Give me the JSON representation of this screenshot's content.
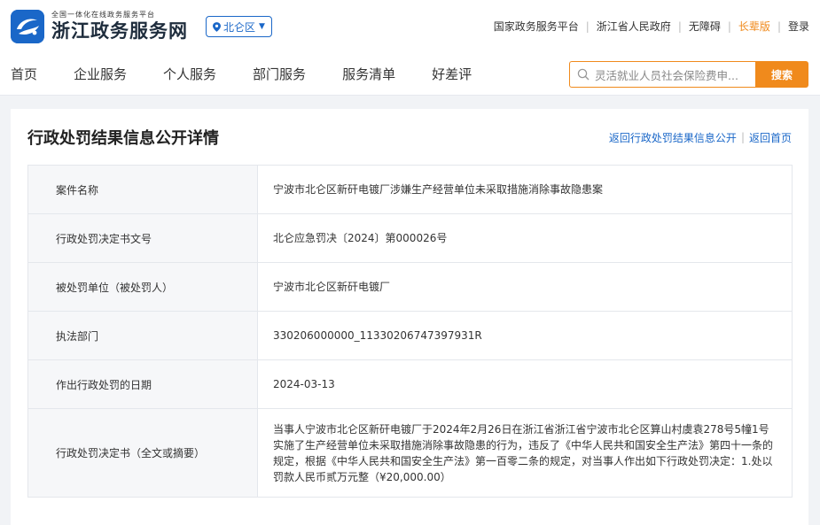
{
  "header": {
    "logo_sub": "全国一体化在线政务服务平台",
    "logo_main": "浙江政务服务网",
    "region": "北仑区",
    "top_links": [
      {
        "label": "国家政务服务平台",
        "accent": false
      },
      {
        "label": "浙江省人民政府",
        "accent": false
      },
      {
        "label": "无障碍",
        "accent": false
      },
      {
        "label": "长辈版",
        "accent": true
      },
      {
        "label": "登录",
        "accent": false
      }
    ]
  },
  "nav": {
    "items": [
      "首页",
      "企业服务",
      "个人服务",
      "部门服务",
      "服务清单",
      "好差评"
    ],
    "search_value": "灵活就业人员社会保险费申...",
    "search_button": "搜索"
  },
  "card": {
    "title": "行政处罚结果信息公开详情",
    "link_back_list": "返回行政处罚结果信息公开",
    "link_home": "返回首页"
  },
  "rows": [
    {
      "label": "案件名称",
      "value": "宁波市北仑区新矸电镀厂涉嫌生产经营单位未采取措施消除事故隐患案"
    },
    {
      "label": "行政处罚决定书文号",
      "value": "北仑应急罚决〔2024〕第000026号"
    },
    {
      "label": "被处罚单位（被处罚人）",
      "value": "宁波市北仑区新矸电镀厂"
    },
    {
      "label": "执法部门",
      "value": "330206000000_11330206747397931R"
    },
    {
      "label": "作出行政处罚的日期",
      "value": "2024-03-13"
    },
    {
      "label": "行政处罚决定书（全文或摘要）",
      "value": "当事人宁波市北仑区新矸电镀厂于2024年2月26日在浙江省浙江省宁波市北仑区算山村虞袁278号5幢1号实施了生产经营单位未采取措施消除事故隐患的行为，违反了《中华人民共和国安全生产法》第四十一条的规定，根据《中华人民共和国安全生产法》第一百零二条的规定，对当事人作出如下行政处罚决定：1.处以罚款人民币贰万元整（¥20,000.00）"
    }
  ],
  "colors": {
    "brand_blue": "#1a67c8",
    "accent_orange": "#f08a1c"
  }
}
